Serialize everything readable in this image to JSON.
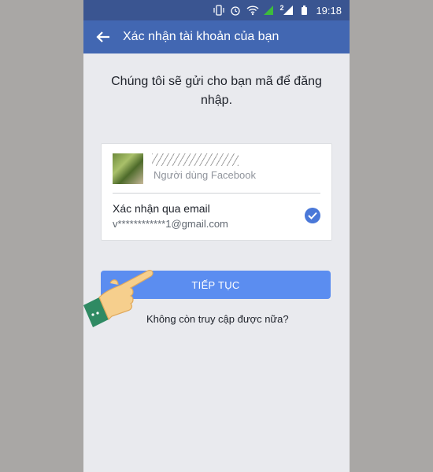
{
  "statusbar": {
    "time": "19:18",
    "sim_label": "2"
  },
  "appbar": {
    "title": "Xác nhận tài khoản của bạn"
  },
  "instruction": "Chúng tôi sẽ gửi cho bạn mã để đăng nhập.",
  "account": {
    "subtitle": "Người dùng Facebook"
  },
  "method": {
    "title": "Xác nhận qua email",
    "email": "v************1@gmail.com"
  },
  "continue_label": "TIẾP TỤC",
  "no_access_link": "Không còn truy cập được nữa?",
  "colors": {
    "appbar": "#4267b2",
    "statusbar": "#3a5591",
    "button": "#5b8df0",
    "check": "#4a78d8"
  }
}
